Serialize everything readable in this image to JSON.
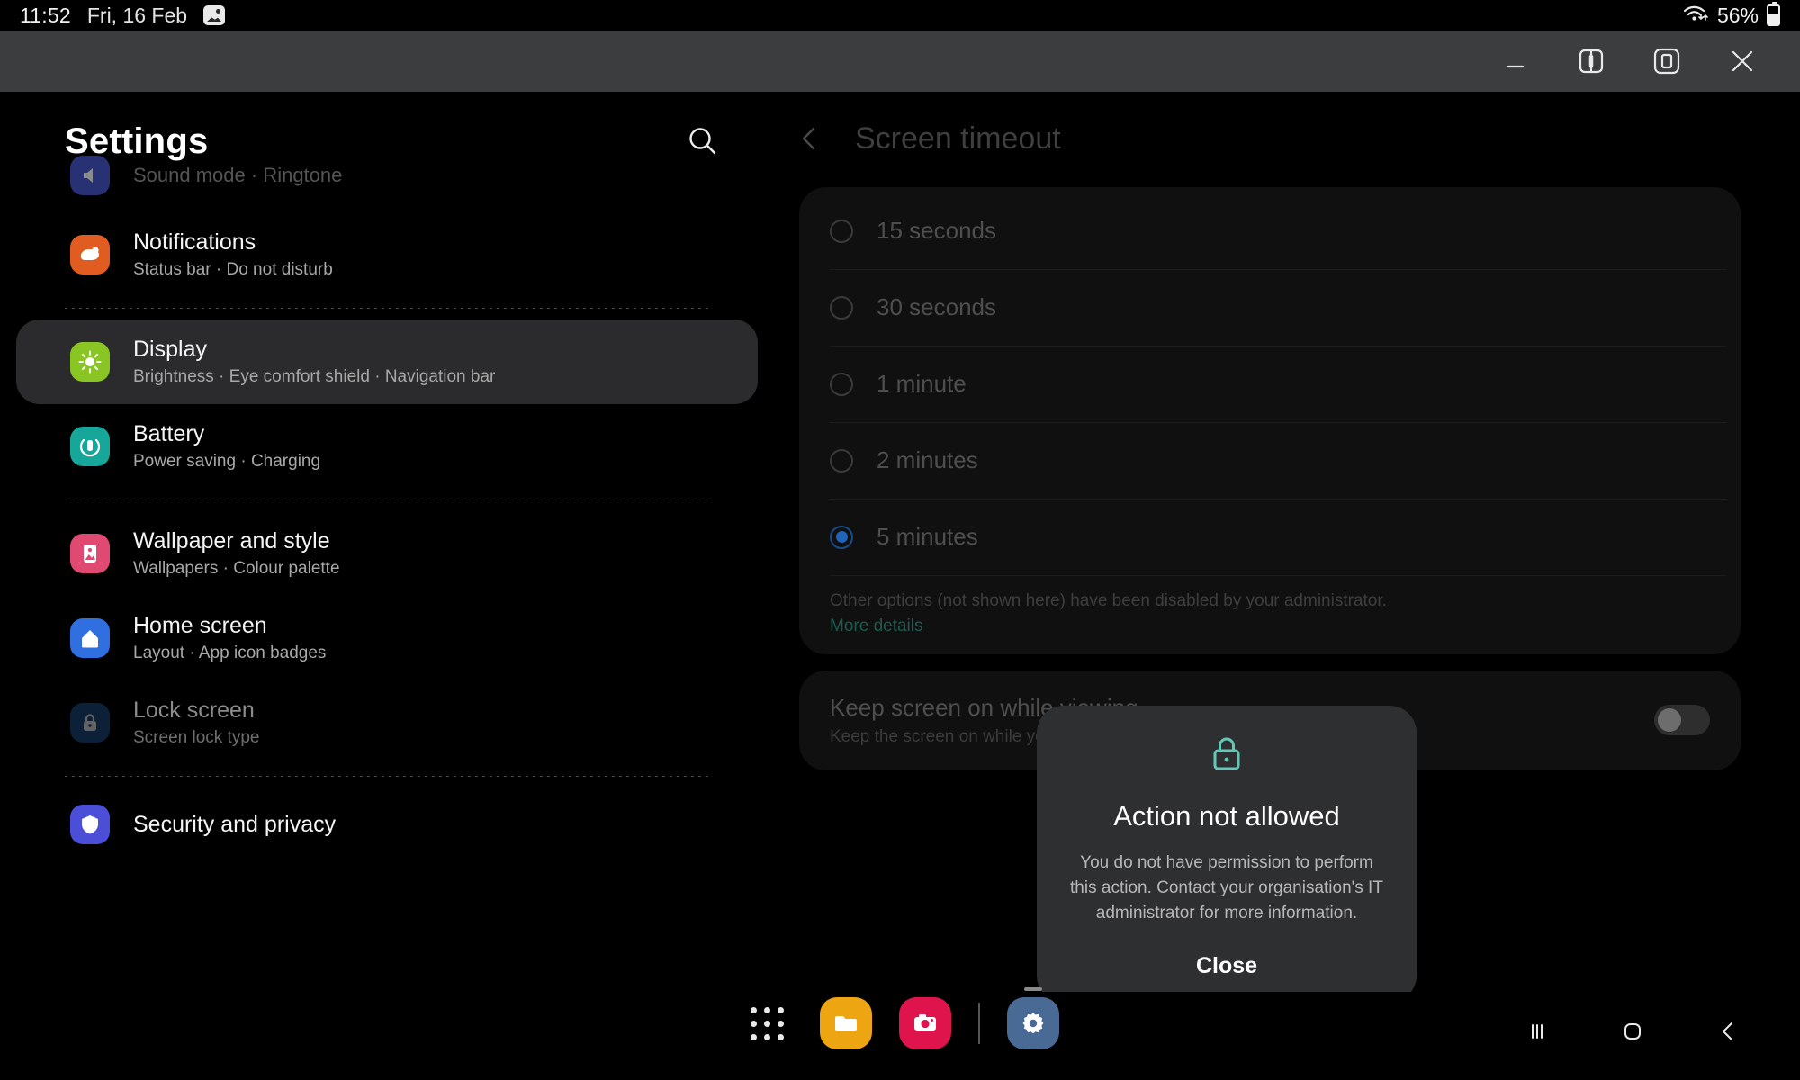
{
  "status_bar": {
    "time": "11:52",
    "date": "Fri, 16 Feb",
    "image_icon": "image-icon",
    "wifi_icon": "wifi-icon",
    "battery_percent": "56%",
    "battery_icon": "battery-icon"
  },
  "window_controls": {
    "minimize": "minimize-icon",
    "split_screen": "split-screen-icon",
    "popup_view": "popup-view-icon",
    "close": "close-icon"
  },
  "sidebar": {
    "title": "Settings",
    "search_icon": "search-icon",
    "items": [
      {
        "title": "Sound mode  ·  Ringtone",
        "subtitle": "",
        "icon": "sound-icon",
        "icon_color": "#4b5ad6",
        "state": "partial"
      },
      {
        "title": "Notifications",
        "subtitle": "Status bar  ·  Do not disturb",
        "icon": "notifications-icon",
        "icon_color": "#e05c20",
        "state": "normal"
      },
      {
        "title": "Display",
        "subtitle": "Brightness  ·  Eye comfort shield  ·  Navigation bar",
        "icon": "display-icon",
        "icon_color": "#89c623",
        "state": "selected"
      },
      {
        "title": "Battery",
        "subtitle": "Power saving  ·  Charging",
        "icon": "battery-settings-icon",
        "icon_color": "#16a79a",
        "state": "normal"
      },
      {
        "title": "Wallpaper and style",
        "subtitle": "Wallpapers  ·  Colour palette",
        "icon": "wallpaper-icon",
        "icon_color": "#e04a72",
        "state": "normal"
      },
      {
        "title": "Home screen",
        "subtitle": "Layout  ·  App icon badges",
        "icon": "home-screen-icon",
        "icon_color": "#2f6fe0",
        "state": "normal"
      },
      {
        "title": "Lock screen",
        "subtitle": "Screen lock type",
        "icon": "lock-screen-icon",
        "icon_color": "#1b4a7a",
        "state": "dimmed"
      },
      {
        "title": "Security and privacy",
        "subtitle": "",
        "icon": "security-icon",
        "icon_color": "#4b4ed6",
        "state": "partial"
      }
    ]
  },
  "detail": {
    "back_icon": "back-chevron-icon",
    "title": "Screen timeout",
    "options": [
      {
        "label": "15 seconds",
        "selected": false
      },
      {
        "label": "30 seconds",
        "selected": false
      },
      {
        "label": "1 minute",
        "selected": false
      },
      {
        "label": "2 minutes",
        "selected": false
      },
      {
        "label": "5 minutes",
        "selected": true
      }
    ],
    "footer_note": "Other options (not shown here) have been disabled by your administrator.",
    "footer_link": "More details",
    "keep_screen": {
      "title": "Keep screen on while viewing",
      "subtitle": "Keep the screen on while you're looking at your face.",
      "toggle_on": false
    }
  },
  "modal": {
    "lock_icon": "lock-icon",
    "lock_icon_color": "#63c9b6",
    "title": "Action not allowed",
    "body": "You do not have permission to perform this action. Contact your organisation's IT administrator for more information.",
    "close_label": "Close"
  },
  "taskbar": {
    "apps_icon": "apps-grid-icon",
    "items": [
      {
        "name": "my-files-app",
        "color": "#eda511"
      },
      {
        "name": "camera-app",
        "color": "#e0144c"
      },
      {
        "name": "settings-app",
        "color": "#4a6a96",
        "running": true
      }
    ],
    "nav": {
      "recents": "recents-icon",
      "home": "home-icon",
      "back": "back-icon"
    }
  },
  "colors": {
    "accent_blue": "#1f63ba",
    "link_green": "#1f5a4f",
    "dialog_bg": "#2e2f31",
    "selected_row_bg": "#2b2b2d"
  }
}
